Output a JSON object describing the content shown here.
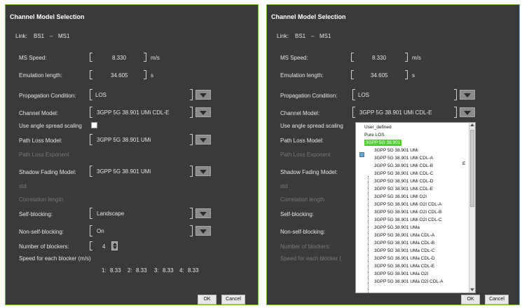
{
  "dialog_title": "Channel Model Selection",
  "link": {
    "label": "Link:",
    "from": "BS1",
    "sep": "–",
    "to": "MS1"
  },
  "ms_speed": {
    "label": "MS Speed:",
    "value": "8.330",
    "unit": "m/s"
  },
  "emulation_length": {
    "label": "Emulation length:",
    "value": "34.605",
    "unit": "s"
  },
  "propagation_condition": {
    "label": "Propagation Condition:",
    "value": "LOS"
  },
  "channel_model": {
    "label": "Channel Model:",
    "value": "3GPP 5G 38.901 UMi CDL-E"
  },
  "angle_spread": {
    "label": "Use angle spread scaling"
  },
  "path_loss_model": {
    "label": "Path Loss Model:",
    "value": "3GPP 5G 38.901 UMi"
  },
  "path_loss_exponent": {
    "label": "Path Loss Exponent"
  },
  "shadow_fading_model": {
    "label": "Shadow Fading Model:",
    "value": "3GPP 5G 38.901 UMi"
  },
  "std": {
    "label": "std"
  },
  "correlation_length": {
    "label": "Correlation length"
  },
  "self_blocking": {
    "label": "Self-blocking:",
    "value": "Landscape"
  },
  "non_self_blocking": {
    "label": "Non-self-blocking:",
    "value": "On"
  },
  "num_blockers": {
    "label": "Number of blockers:",
    "value": "4"
  },
  "blocker_speed": {
    "label": "Speed for each blocker (m/s)",
    "label_truncated": "Speed for each blocker (",
    "items": [
      {
        "idx": "1:",
        "val": "8.33"
      },
      {
        "idx": "2:",
        "val": "8.33"
      },
      {
        "idx": "3:",
        "val": "8.33"
      },
      {
        "idx": "4:",
        "val": "8.33"
      }
    ]
  },
  "buttons": {
    "ok": "OK",
    "cancel": "Cancel"
  },
  "right_panel": {
    "angle_spread_truncated": "Use angle spread scaling"
  },
  "dropdown_tree": {
    "items": [
      "User_defined",
      "Pure LOS",
      "3GPP 5G 38.901",
      "3GPP 5G 38.901 UMi",
      "3GPP 5G 38.901 UMi CDL-A",
      "3GPP 5G 38.901 UMi CDL-B",
      "3GPP 5G 38.901 UMi CDL-C",
      "3GPP 5G 38.901 UMi CDL-D",
      "3GPP 5G 38.901 UMi CDL-E",
      "3GPP 5G 38.901 UMi O2I",
      "3GPP 5G 38.901 UMi O2I CDL-A",
      "3GPP 5G 38.901 UMi O2I CDL-B",
      "3GPP 5G 38.901 UMi O2I CDL-C",
      "3GPP 5G 38.901 UMa",
      "3GPP 5G 38.901 UMa CDL-A",
      "3GPP 5G 38.901 UMa CDL-B",
      "3GPP 5G 38.901 UMa CDL-C",
      "3GPP 5G 38.901 UMa CDL-D",
      "3GPP 5G 38.901 UMa CDL-E",
      "3GPP 5G 38.901 UMa O2I",
      "3GPP 5G 38.901 UMa O2I CDL-A"
    ],
    "selected": "3GPP 5G 38.901",
    "letter": "E"
  },
  "colors": {
    "panel_bg": "#3a3a3a",
    "border_accent": "#6cbf3a",
    "selected_item": "#4cd12e"
  }
}
